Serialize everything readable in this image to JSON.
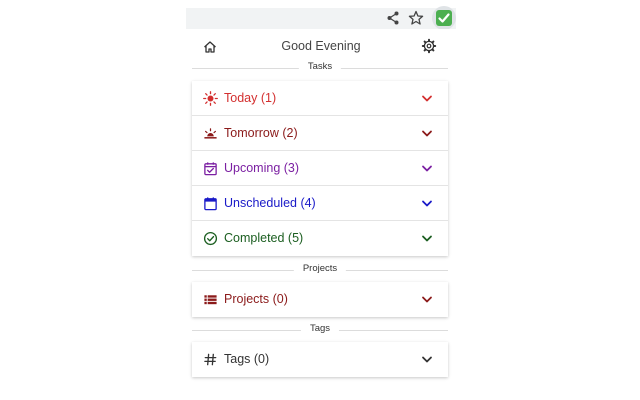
{
  "header": {
    "title": "Good Evening"
  },
  "sections": {
    "tasks": "Tasks",
    "projects": "Projects",
    "tags": "Tags"
  },
  "tasks": [
    {
      "label": "Today (1)",
      "icon": "sun-icon",
      "color": "#d32f2f"
    },
    {
      "label": "Tomorrow (2)",
      "icon": "sunrise-icon",
      "color": "#8b1a1a"
    },
    {
      "label": "Upcoming (3)",
      "icon": "calendar-check-icon",
      "color": "#7b1fa2"
    },
    {
      "label": "Unscheduled (4)",
      "icon": "calendar-icon",
      "color": "#1a1ac8"
    },
    {
      "label": "Completed (5)",
      "icon": "check-circle-icon",
      "color": "#1b5e20"
    }
  ],
  "projects": {
    "label": "Projects (0)",
    "icon": "list-icon",
    "color": "#8b1a1a"
  },
  "tags": {
    "label": "Tags (0)",
    "icon": "hash-icon",
    "color": "#333333"
  }
}
